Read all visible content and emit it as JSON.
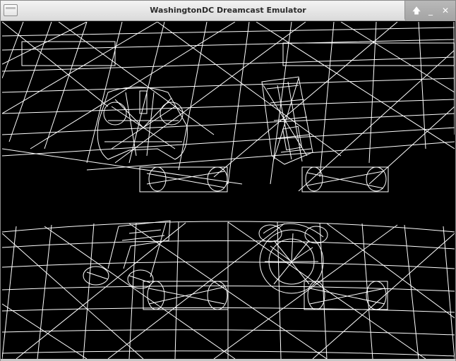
{
  "window": {
    "title": "WashingtonDC Dreamcast Emulator",
    "controls": {
      "maximize_icon": "🡅",
      "minimize_icon": "_",
      "close_icon": "✕"
    }
  },
  "scene": {
    "description_icons": [
      "controller-icon",
      "vmu-icon",
      "music-note-icon",
      "clock-icon"
    ],
    "wire_color": "#ffffff",
    "background_color": "#000000"
  }
}
